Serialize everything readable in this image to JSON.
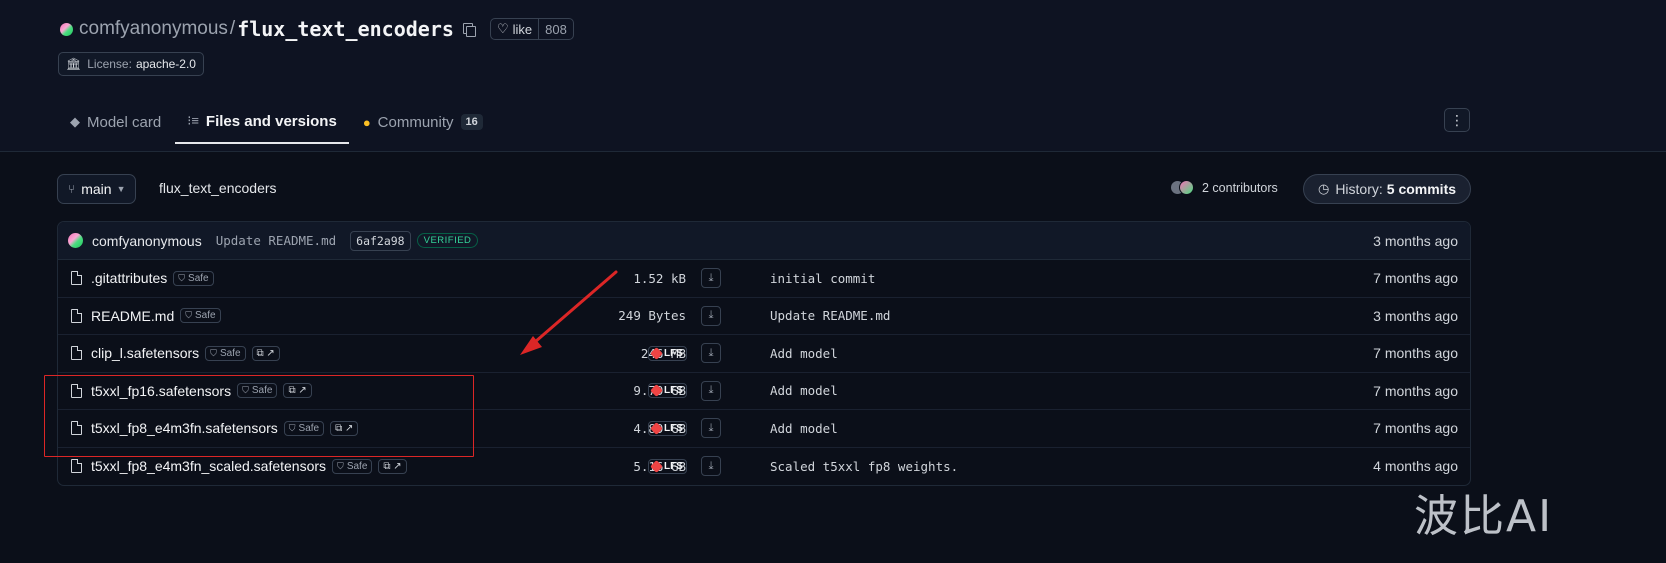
{
  "repo": {
    "owner": "comfyanonymous",
    "separator": "/",
    "name": "flux_text_encoders",
    "like_label": "like",
    "like_count": "808",
    "license_label": "License:",
    "license_value": "apache-2.0"
  },
  "tabs": [
    {
      "label": "Model card",
      "icon": "cube-icon"
    },
    {
      "label": "Files and versions",
      "icon": "files-icon",
      "active": true
    },
    {
      "label": "Community",
      "icon": "community-icon",
      "badge": "16"
    }
  ],
  "more_icon": "⋮",
  "branch": {
    "label": "main",
    "breadcrumb": "flux_text_encoders"
  },
  "contributors_label": "2 contributors",
  "history": {
    "label": "History:",
    "count": "5 commits"
  },
  "last_commit": {
    "author": "comfyanonymous",
    "message": "Update README.md",
    "hash": "6af2a98",
    "verified": "VERIFIED",
    "date": "3 months ago"
  },
  "files": [
    {
      "name": ".gitattributes",
      "safe": "Safe",
      "xet": false,
      "size": "1.52 kB",
      "lfs": false,
      "message": "initial commit",
      "date": "7 months ago"
    },
    {
      "name": "README.md",
      "safe": "Safe",
      "xet": false,
      "size": "249 Bytes",
      "lfs": false,
      "message": "Update README.md",
      "date": "3 months ago"
    },
    {
      "name": "clip_l.safetensors",
      "safe": "Safe",
      "xet": true,
      "size": "246 MB",
      "lfs": true,
      "message": "Add model",
      "date": "7 months ago"
    },
    {
      "name": "t5xxl_fp16.safetensors",
      "safe": "Safe",
      "xet": true,
      "size": "9.79 GB",
      "lfs": true,
      "message": "Add model",
      "date": "7 months ago"
    },
    {
      "name": "t5xxl_fp8_e4m3fn.safetensors",
      "safe": "Safe",
      "xet": true,
      "size": "4.89 GB",
      "lfs": true,
      "message": "Add model",
      "date": "7 months ago"
    },
    {
      "name": "t5xxl_fp8_e4m3fn_scaled.safetensors",
      "safe": "Safe",
      "xet": true,
      "size": "5.16 GB",
      "lfs": true,
      "message": "Scaled t5xxl fp8 weights.",
      "date": "4 months ago"
    }
  ],
  "lfs_label": "LFS",
  "watermark": "波比AI",
  "colors": {
    "background": "#0b0f19",
    "annotation_red": "#dc2626",
    "verified_green": "#34d399"
  }
}
